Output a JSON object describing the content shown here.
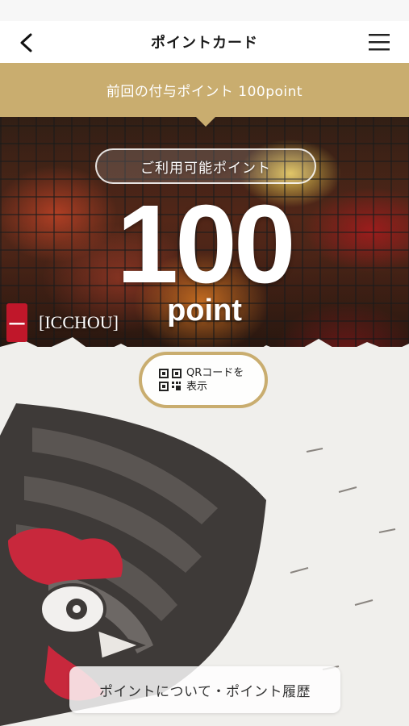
{
  "header": {
    "title": "ポイントカード"
  },
  "banner": {
    "text": "前回の付与ポイント 100point"
  },
  "card": {
    "available_label": "ご利用可能ポイント",
    "points": "100",
    "unit": "point",
    "brand": "[ICCHOU]"
  },
  "qr_button": {
    "line1": "QRコードを",
    "line2": "表示"
  },
  "footer": {
    "history_label": "ポイントについて・ポイント履歴"
  },
  "colors": {
    "gold": "#c9ad6f",
    "brand_red": "#c0172a"
  },
  "icons": [
    "back-icon",
    "menu-icon",
    "qr-code-icon",
    "brand-logo"
  ]
}
